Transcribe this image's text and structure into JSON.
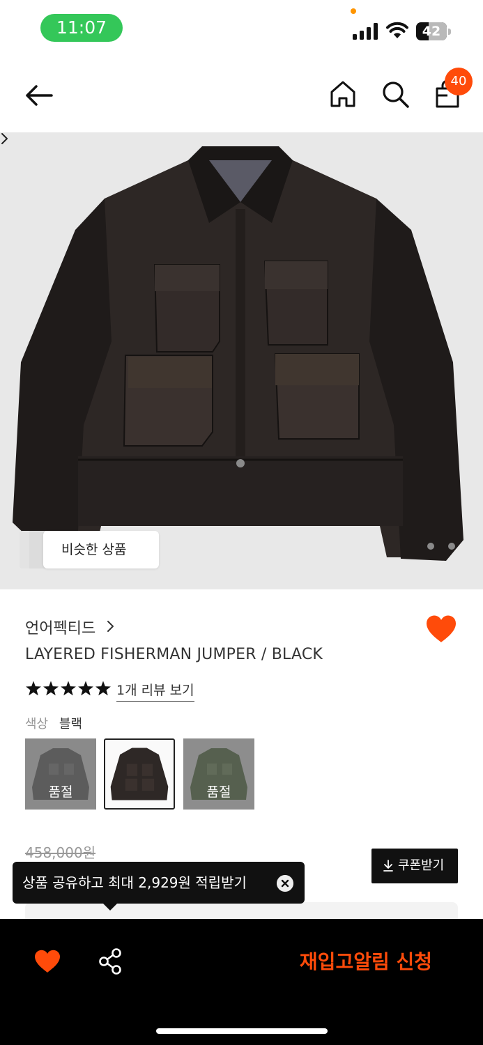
{
  "status_bar": {
    "time": "11:07",
    "battery": "42",
    "battery_level": 0.42,
    "time_pill_color": "#34c759"
  },
  "header": {
    "back_icon": "arrow-left-icon",
    "home_icon": "home-icon",
    "search_icon": "search-icon",
    "cart_icon": "shopping-bag-icon",
    "cart_count": "40",
    "badge_color": "#ff4b0a"
  },
  "gallery": {
    "similar_label": "비슷한 상품"
  },
  "product": {
    "brand": "언어펙티드",
    "name": "LAYERED FISHERMAN JUMPER / BLACK",
    "rating": 5,
    "review_link": "1개 리뷰 보기",
    "color_label": "색상",
    "color_value": "블랙",
    "swatches": [
      {
        "label": "품절",
        "sold_out": true
      },
      {
        "label": "",
        "sold_out": false,
        "selected": true
      },
      {
        "label": "품절",
        "sold_out": true
      }
    ],
    "original_price": "458,000원",
    "coupon_label": "쿠폰받기"
  },
  "tooltip": {
    "text": "상품 공유하고 최대 2,929원 적립받기"
  },
  "bottom_bar": {
    "wish_icon": "heart-icon",
    "share_icon": "share-icon",
    "restock_label": "재입고알림 신청",
    "accent_color": "#ff4b0a"
  }
}
